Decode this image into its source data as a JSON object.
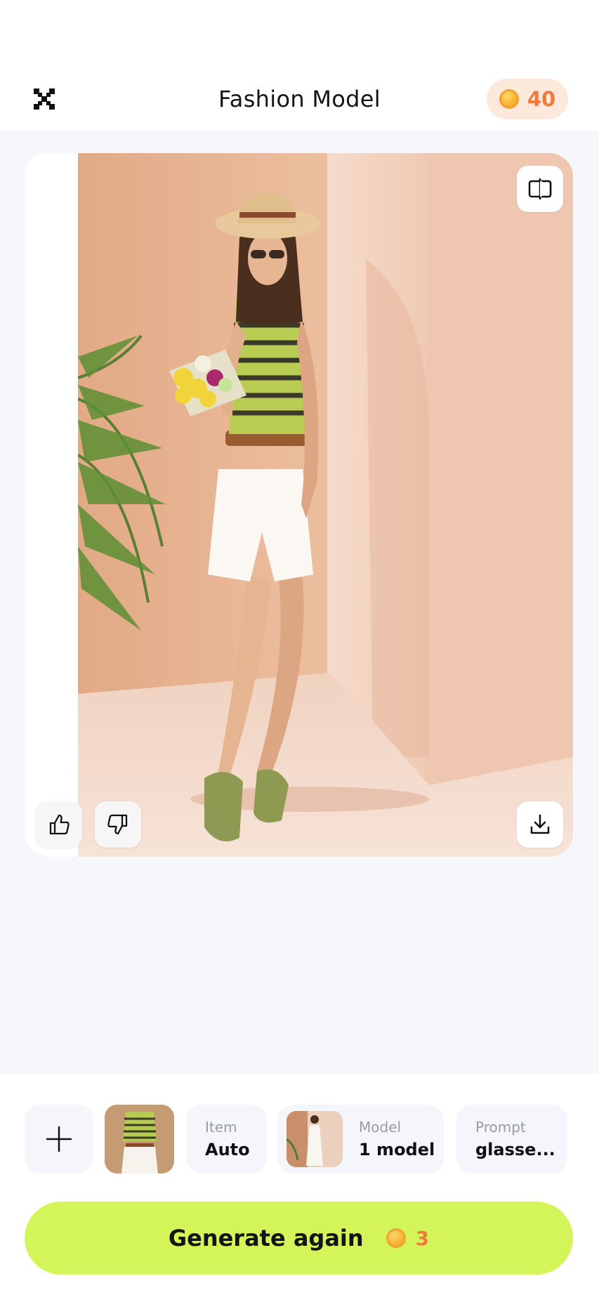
{
  "header": {
    "title": "Fashion Model",
    "close_icon": "close-icon",
    "coins": {
      "icon": "coin-icon",
      "value": "40"
    }
  },
  "result": {
    "compare_icon": "compare-icon",
    "like_icon": "thumbs-up-icon",
    "dislike_icon": "thumbs-down-icon",
    "download_icon": "download-icon"
  },
  "options": {
    "add_icon": "plus-icon",
    "item": {
      "label": "Item",
      "value": "Auto"
    },
    "model": {
      "label": "Model",
      "value": "1 model"
    },
    "prompt": {
      "label": "Prompt",
      "value": "glasse..."
    }
  },
  "generate": {
    "label": "Generate again",
    "cost": "3",
    "coin_icon": "coin-icon"
  },
  "colors": {
    "accent": "#d4f55a",
    "coin_text": "#f07a3a",
    "coin_badge_bg": "#fde8dc",
    "background": "#f6f7fb"
  }
}
